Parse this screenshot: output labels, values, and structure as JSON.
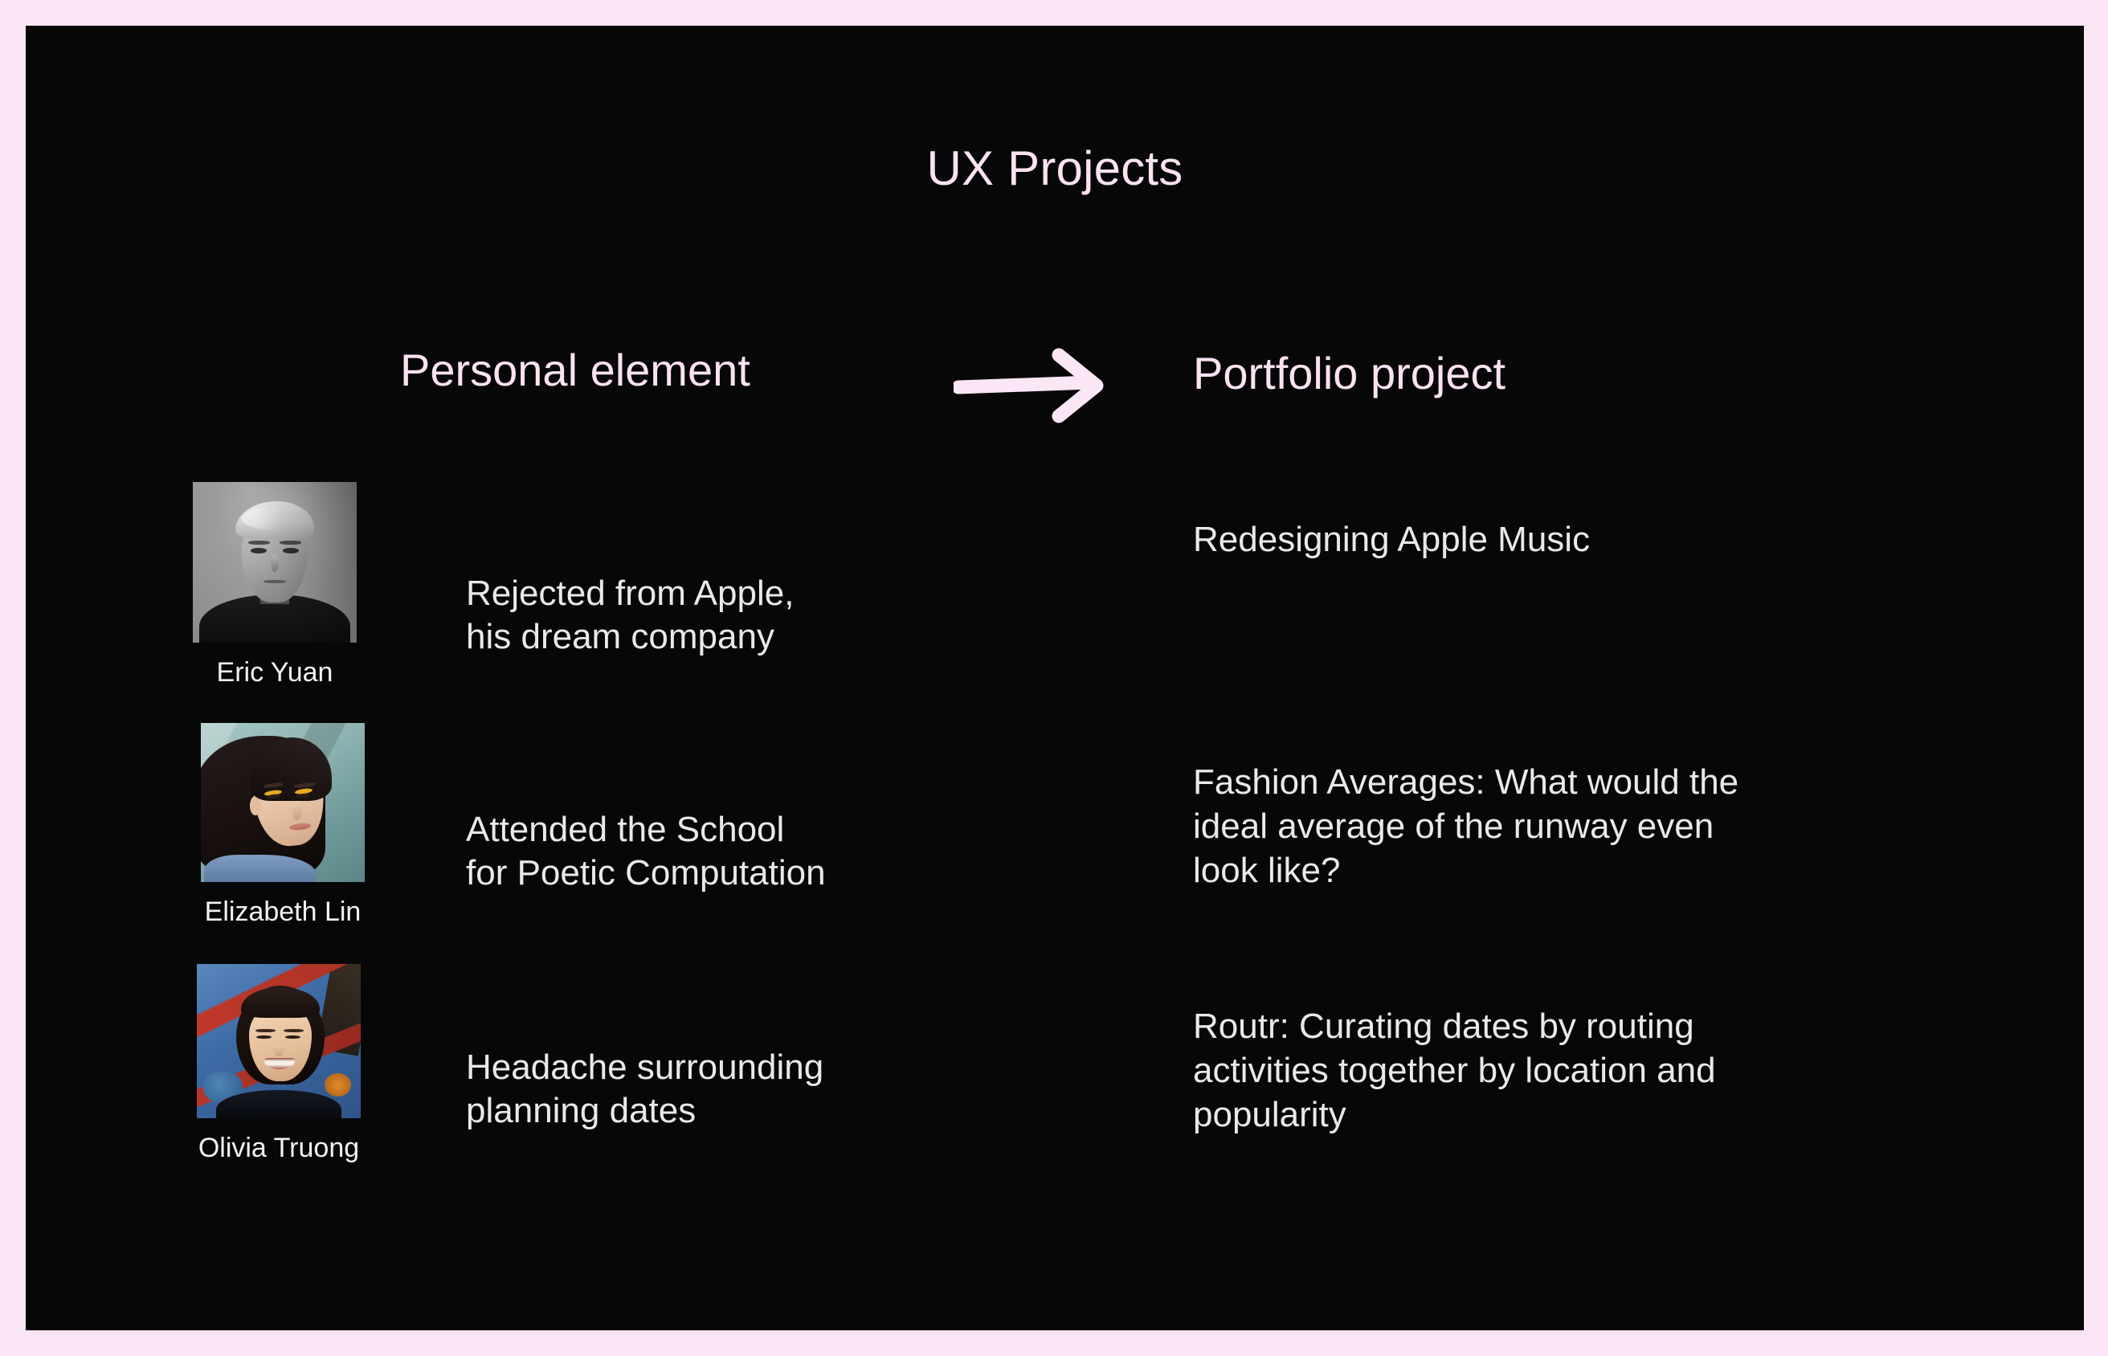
{
  "slide": {
    "title": "UX Projects",
    "frame_color": "#fae5f4",
    "panel_color": "#070707",
    "accent_color": "#fae2f2",
    "body_text_color": "#e9e9e9"
  },
  "columns": {
    "left_header": "Personal element",
    "right_header": "Portfolio project",
    "arrow_icon": "right-arrow-icon"
  },
  "rows": [
    {
      "person_name": "Eric Yuan",
      "photo_alt": "eric-yuan-portrait",
      "personal_element": "Rejected from Apple,\nhis dream company",
      "personal_element_lines": [
        "Rejected from Apple,",
        "his dream company"
      ],
      "portfolio_project": "Redesigning Apple Music",
      "portfolio_project_lines": [
        "Redesigning Apple Music"
      ]
    },
    {
      "person_name": "Elizabeth Lin",
      "photo_alt": "elizabeth-lin-portrait",
      "personal_element": "Attended the School\nfor Poetic Computation",
      "personal_element_lines": [
        "Attended the School",
        "for Poetic Computation"
      ],
      "portfolio_project": "Fashion Averages: What would the ideal average of the runway even look like?",
      "portfolio_project_lines": [
        "Fashion Averages: What would the",
        "ideal average of the runway even",
        "look like?"
      ]
    },
    {
      "person_name": "Olivia Truong",
      "photo_alt": "olivia-truong-portrait",
      "personal_element": "Headache surrounding\nplanning dates",
      "personal_element_lines": [
        "Headache surrounding",
        "planning dates"
      ],
      "portfolio_project": "Routr: Curating dates by routing activities together by location and popularity",
      "portfolio_project_lines": [
        "Routr: Curating dates by routing",
        "activities together by location and",
        "popularity"
      ]
    }
  ]
}
